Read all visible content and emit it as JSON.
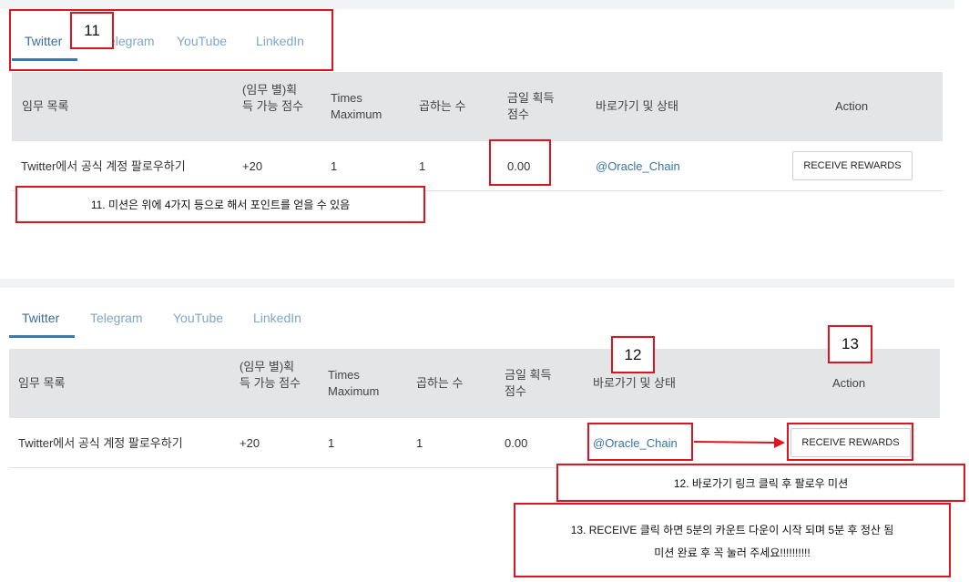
{
  "panel1": {
    "tabs": [
      {
        "label": "Twitter",
        "active": true
      },
      {
        "label": "Telegram",
        "active": false
      },
      {
        "label": "YouTube",
        "active": false
      },
      {
        "label": "LinkedIn",
        "active": false
      }
    ],
    "headers": {
      "mission": "임무 목록",
      "points": "(임무 별)획득 가능 점수",
      "times": "Times Maximum",
      "multiplier": "곱하는 수",
      "today": "금일 획득 점수",
      "shortcut": "바로가기 및 상태",
      "action": "Action"
    },
    "row": {
      "mission": "Twitter에서 공식 계정 팔로우하기",
      "points": "+20",
      "times": "1",
      "multiplier": "1",
      "today": "0.00",
      "link": "@Oracle_Chain",
      "button": "RECEIVE REWARDS"
    },
    "annotations": {
      "badge": "11",
      "note": "11. 미션은 위에 4가지 등으로 해서 포인트를 얻을 수 있음"
    }
  },
  "panel2": {
    "tabs": [
      {
        "label": "Twitter",
        "active": true
      },
      {
        "label": "Telegram",
        "active": false
      },
      {
        "label": "YouTube",
        "active": false
      },
      {
        "label": "LinkedIn",
        "active": false
      }
    ],
    "headers": {
      "mission": "임무 목록",
      "points": "(임무 별)획득 가능 점수",
      "times": "Times Maximum",
      "multiplier": "곱하는 수",
      "today": "금일 획득 점수",
      "shortcut": "바로가기 및 상태",
      "action": "Action"
    },
    "row": {
      "mission": "Twitter에서 공식 계정 팔로우하기",
      "points": "+20",
      "times": "1",
      "multiplier": "1",
      "today": "0.00",
      "link": "@Oracle_Chain",
      "button": "RECEIVE REWARDS"
    },
    "annotations": {
      "badge12": "12",
      "badge13": "13",
      "note12": "12.  바로가기 링크 클릭 후 팔로우 미션",
      "note13_line1": "13.  RECEIVE 클릭 하면 5분의 카운트 다운이 시작 되며 5분 후 정산 됨",
      "note13_line2": "미션 완료 후 꼭 눌러 주세요!!!!!!!!!!"
    }
  },
  "colors": {
    "annotation_red": "#e0141e",
    "tab_active": "#3a6e9a",
    "tab_inactive": "#7fa7c9",
    "link": "#3a73a8",
    "header_bg": "#e4e5e7"
  }
}
